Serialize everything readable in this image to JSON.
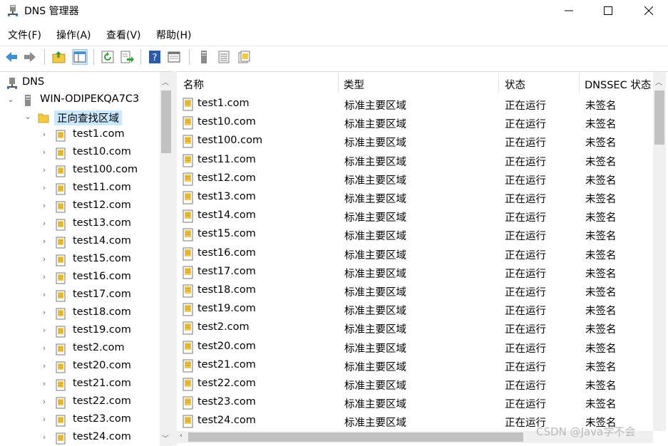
{
  "window": {
    "title": "DNS 管理器"
  },
  "menu": [
    "文件(F)",
    "操作(A)",
    "查看(V)",
    "帮助(H)"
  ],
  "toolbar_icons": [
    "back-arrow-icon",
    "forward-arrow-icon",
    "up-folder-icon",
    "show-hide-tree-icon",
    "refresh-icon",
    "export-list-icon",
    "help-icon",
    "properties-icon",
    "server-icon",
    "list-view-icon",
    "zone-icon"
  ],
  "tree": {
    "root": "DNS",
    "server": "WIN-ODIPEKQA7C3",
    "folder": "正向查找区域",
    "zones": [
      "test1.com",
      "test10.com",
      "test100.com",
      "test11.com",
      "test12.com",
      "test13.com",
      "test14.com",
      "test15.com",
      "test16.com",
      "test17.com",
      "test18.com",
      "test19.com",
      "test2.com",
      "test20.com",
      "test21.com",
      "test22.com",
      "test23.com",
      "test24.com"
    ]
  },
  "list": {
    "columns": [
      "名称",
      "类型",
      "状态",
      "DNSSEC 状态"
    ],
    "rows": [
      [
        "test1.com",
        "标准主要区域",
        "正在运行",
        "未签名"
      ],
      [
        "test10.com",
        "标准主要区域",
        "正在运行",
        "未签名"
      ],
      [
        "test100.com",
        "标准主要区域",
        "正在运行",
        "未签名"
      ],
      [
        "test11.com",
        "标准主要区域",
        "正在运行",
        "未签名"
      ],
      [
        "test12.com",
        "标准主要区域",
        "正在运行",
        "未签名"
      ],
      [
        "test13.com",
        "标准主要区域",
        "正在运行",
        "未签名"
      ],
      [
        "test14.com",
        "标准主要区域",
        "正在运行",
        "未签名"
      ],
      [
        "test15.com",
        "标准主要区域",
        "正在运行",
        "未签名"
      ],
      [
        "test16.com",
        "标准主要区域",
        "正在运行",
        "未签名"
      ],
      [
        "test17.com",
        "标准主要区域",
        "正在运行",
        "未签名"
      ],
      [
        "test18.com",
        "标准主要区域",
        "正在运行",
        "未签名"
      ],
      [
        "test19.com",
        "标准主要区域",
        "正在运行",
        "未签名"
      ],
      [
        "test2.com",
        "标准主要区域",
        "正在运行",
        "未签名"
      ],
      [
        "test20.com",
        "标准主要区域",
        "正在运行",
        "未签名"
      ],
      [
        "test21.com",
        "标准主要区域",
        "正在运行",
        "未签名"
      ],
      [
        "test22.com",
        "标准主要区域",
        "正在运行",
        "未签名"
      ],
      [
        "test23.com",
        "标准主要区域",
        "正在运行",
        "未签名"
      ],
      [
        "test24.com",
        "标准主要区域",
        "正在运行",
        "未签名"
      ]
    ]
  },
  "watermark": "CSDN @Java学不会",
  "colors": {
    "selection": "#cce8ff",
    "folder": "#f5c842",
    "help": "#2a5aa8",
    "arrow": "#3b8ed8"
  }
}
